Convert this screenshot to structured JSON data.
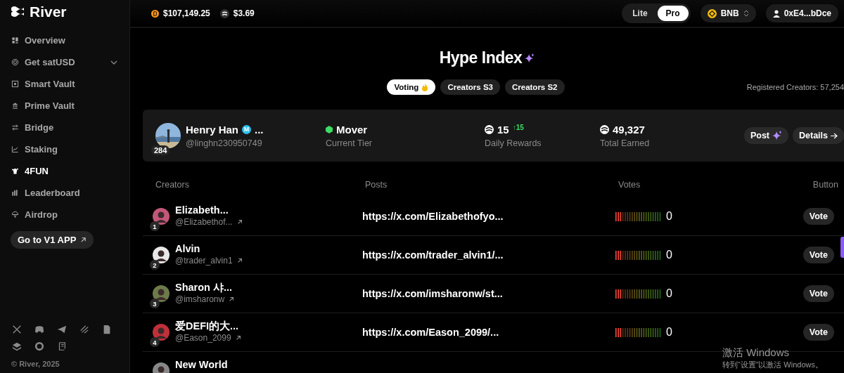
{
  "sidebar": {
    "logo": "River",
    "nav": [
      {
        "label": "Overview",
        "selected": false,
        "expandable": false
      },
      {
        "label": "Get satUSD",
        "selected": false,
        "expandable": true
      },
      {
        "label": "Smart Vault",
        "selected": false,
        "expandable": false
      },
      {
        "label": "Prime Vault",
        "selected": false,
        "expandable": false
      },
      {
        "label": "Bridge",
        "selected": false,
        "expandable": false
      },
      {
        "label": "Staking",
        "selected": false,
        "expandable": false
      },
      {
        "label": "4FUN",
        "selected": true,
        "expandable": false
      },
      {
        "label": "Leaderboard",
        "selected": false,
        "expandable": false
      },
      {
        "label": "Airdrop",
        "selected": false,
        "expandable": false
      }
    ],
    "v1_button": "Go to V1 APP",
    "copyright": "© River, 2025"
  },
  "topbar": {
    "prices": [
      {
        "kind": "btc",
        "value": "$107,149.25"
      },
      {
        "kind": "river",
        "value": "$3.69"
      }
    ],
    "modes": [
      {
        "label": "Lite",
        "selected": false
      },
      {
        "label": "Pro",
        "selected": true
      }
    ],
    "network": "BNB",
    "wallet": "0xE4...bDce"
  },
  "title": "Hype Index",
  "tabs": [
    {
      "label": "Voting",
      "selected": true
    },
    {
      "label": "Creators S3",
      "selected": false
    },
    {
      "label": "Creators S2",
      "selected": false
    }
  ],
  "registered": "Registered Creators: 57,254",
  "profile": {
    "name": "Henry Han",
    "badge": "M",
    "name_more": "...",
    "handle": "@linghn230950749",
    "rank": "284",
    "tier": "Mover",
    "tier_label": "Current Tier",
    "daily": "15",
    "daily_change": "↑15",
    "daily_label": "Daily Rewards",
    "total": "49,327",
    "total_label": "Total Earned",
    "buttons": [
      "Post",
      "Details"
    ]
  },
  "table": {
    "columns": [
      "Creators",
      "Posts",
      "Votes",
      "Button"
    ],
    "rows": [
      {
        "rank": "1",
        "name": "Elizabeth...",
        "handle": "@Elizabethof...",
        "post": "https://x.com/Elizabethofyo...",
        "votes": "0",
        "button": "Vote"
      },
      {
        "rank": "2",
        "name": "Alvin",
        "handle": "@trader_alvin1",
        "post": "https://x.com/trader_alvin1/...",
        "votes": "0",
        "button": "Vote"
      },
      {
        "rank": "3",
        "name": "Sharon 샤...",
        "handle": "@imsharonw",
        "post": "https://x.com/imsharonw/st...",
        "votes": "0",
        "button": "Vote"
      },
      {
        "rank": "4",
        "name": "爱DEFI的大...",
        "handle": "@Eason_2099",
        "post": "https://x.com/Eason_2099/...",
        "votes": "0",
        "button": "Vote"
      },
      {
        "name": "New World"
      }
    ]
  },
  "os_notice": [
    "激活 Windows",
    "转到“设置”以激活 Windows。"
  ]
}
